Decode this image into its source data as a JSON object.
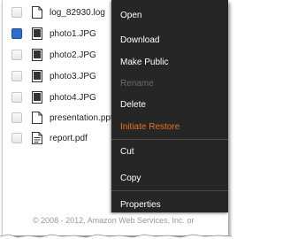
{
  "files": [
    {
      "name": "log_82930.log",
      "icon": "document-icon",
      "checked": false
    },
    {
      "name": "photo1.JPG",
      "icon": "image-icon",
      "checked": true
    },
    {
      "name": "photo2.JPG",
      "icon": "image-icon",
      "checked": false
    },
    {
      "name": "photo3.JPG",
      "icon": "image-icon",
      "checked": false
    },
    {
      "name": "photo4.JPG",
      "icon": "image-icon",
      "checked": false
    },
    {
      "name": "presentation.pptx",
      "icon": "document-icon",
      "checked": false
    },
    {
      "name": "report.pdf",
      "icon": "pdf-icon",
      "checked": false
    }
  ],
  "context_menu": {
    "open": "Open",
    "download": "Download",
    "make_public": "Make Public",
    "rename": "Rename",
    "delete": "Delete",
    "initiate_restore": "Initiate Restore",
    "cut": "Cut",
    "copy": "Copy",
    "properties": "Properties"
  },
  "footer": "© 2008 - 2012, Amazon Web Services, Inc. or",
  "colors": {
    "menu_bg": "#262626",
    "menu_text": "#ffffff",
    "menu_disabled": "#6b6b6b",
    "restore_accent": "#e8741c",
    "checked": "#2d6fd1"
  }
}
